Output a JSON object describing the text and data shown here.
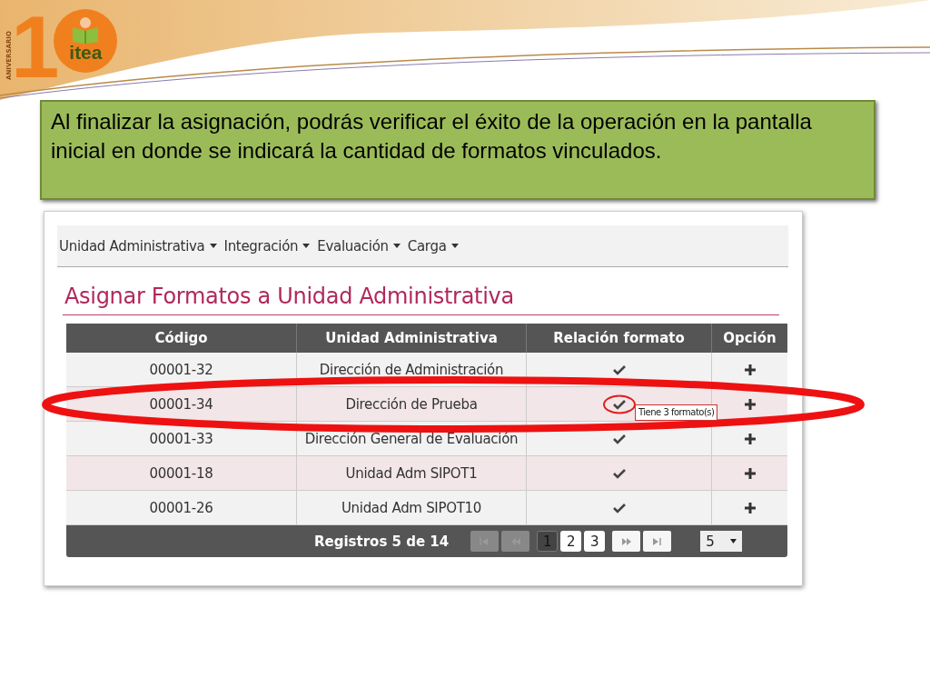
{
  "logo": {
    "vertical_text": "ANIVERSARIO",
    "number": "1",
    "name": "itea"
  },
  "callout": {
    "text": "Al finalizar la asignación, podrás verificar el éxito de la operación en la pantalla inicial en donde se indicará la cantidad de formatos vinculados."
  },
  "menu": [
    {
      "label": "Unidad Administrativa"
    },
    {
      "label": "Integración"
    },
    {
      "label": "Evaluación"
    },
    {
      "label": "Carga"
    }
  ],
  "title": "Asignar Formatos a Unidad Administrativa",
  "table": {
    "columns": [
      "Código",
      "Unidad Administrativa",
      "Relación formato",
      "Opción"
    ],
    "rows": [
      {
        "code": "00001-32",
        "unit": "Dirección de Administración",
        "linked": true
      },
      {
        "code": "00001-34",
        "unit": "Dirección de Prueba",
        "linked": true,
        "tooltip": "Tiene 3 formato(s)",
        "highlighted": true
      },
      {
        "code": "00001-33",
        "unit": "Dirección General de Evaluación",
        "linked": true
      },
      {
        "code": "00001-18",
        "unit": "Unidad Adm SIPOT1",
        "linked": true
      },
      {
        "code": "00001-26",
        "unit": "Unidad Adm SIPOT10",
        "linked": true
      }
    ]
  },
  "footer": {
    "records": "Registros 5 de 14",
    "nav": [
      {
        "kind": "first",
        "disabled": true
      },
      {
        "kind": "prev",
        "disabled": true
      },
      {
        "kind": "next",
        "disabled": false
      },
      {
        "kind": "last",
        "disabled": false
      }
    ],
    "pages": [
      {
        "label": "1",
        "selected": true
      },
      {
        "label": "2",
        "selected": false
      },
      {
        "label": "3",
        "selected": false
      }
    ],
    "page_size": "5"
  }
}
